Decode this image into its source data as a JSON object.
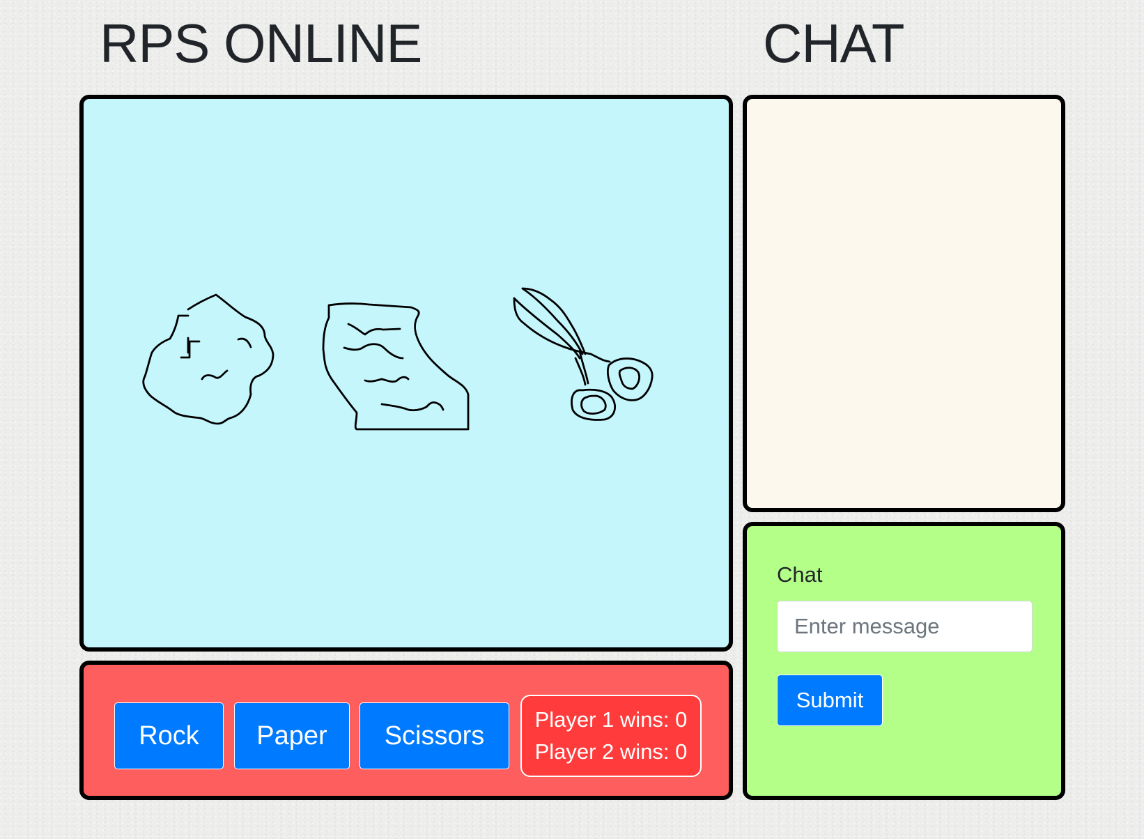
{
  "game": {
    "title": "RPS ONLINE",
    "choices": {
      "rock": "Rock",
      "paper": "Paper",
      "scissors": "Scissors"
    },
    "score": {
      "player1": "Player 1 wins: 0",
      "player2": "Player 2 wins: 0"
    },
    "illustrations": [
      "rock-drawing",
      "paper-drawing",
      "scissors-drawing"
    ]
  },
  "chat": {
    "title": "CHAT",
    "messages": [],
    "form": {
      "label": "Chat",
      "placeholder": "Enter message",
      "value": "",
      "submit_label": "Submit"
    }
  },
  "colors": {
    "game_canvas_bg": "#c5f6fc",
    "controls_bg": "#ff5e5e",
    "score_bg": "#ff3b3b",
    "chat_log_bg": "#fdf8ee",
    "chat_form_bg": "#b4ff88",
    "button_primary": "#007bff"
  }
}
